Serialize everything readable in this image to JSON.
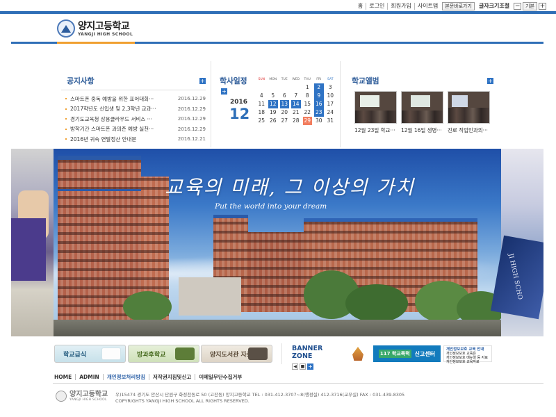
{
  "topbar": {
    "links": [
      "홈",
      "로그인",
      "회원가입",
      "사이트맵"
    ],
    "main_site": "본문바로가기",
    "font_size_label": "글자크기조절",
    "minus": "−",
    "default": "기본",
    "plus": "+"
  },
  "header": {
    "logo_kr": "양지고등학교",
    "logo_en": "YANGJI HIGH SCHOOL"
  },
  "notice": {
    "title": "공지사항",
    "more": "+",
    "items": [
      {
        "title": "스마트폰 중독 예방을 위한 표어대회···",
        "date": "2016.12.29"
      },
      {
        "title": "2017학년도 신입생 및 2,3학년 교과···",
        "date": "2016.12.29"
      },
      {
        "title": "경기도교육청 상용클라우드 서비스 ···",
        "date": "2016.12.29"
      },
      {
        "title": "방학기간 스마트폰 과의존 예방 실천···",
        "date": "2016.12.29"
      },
      {
        "title": "2016년 귀속 연말정산 안내문",
        "date": "2016.12.21"
      }
    ]
  },
  "calendar": {
    "title": "학사일정",
    "more": "+",
    "year": "2016",
    "month": "12",
    "weekdays": [
      "SUN",
      "MON",
      "TUE",
      "WED",
      "THU",
      "FRI",
      "SAT"
    ],
    "weeks": [
      [
        "",
        "",
        "",
        "",
        "1",
        "2",
        "3"
      ],
      [
        "4",
        "5",
        "6",
        "7",
        "8",
        "9",
        "10"
      ],
      [
        "11",
        "12",
        "13",
        "14",
        "15",
        "16",
        "17"
      ],
      [
        "18",
        "19",
        "20",
        "21",
        "22",
        "23",
        "24"
      ],
      [
        "25",
        "26",
        "27",
        "28",
        "29",
        "30",
        "31"
      ]
    ],
    "event_days": [
      "2",
      "9",
      "12",
      "13",
      "14",
      "16",
      "23"
    ],
    "today": "29",
    "colors": {
      "event": "#2f73c4",
      "today": "#f27d5e"
    }
  },
  "album": {
    "title": "학교앨범",
    "more": "+",
    "captions": [
      "12월 23일 학교···",
      "12월 16일 생명···",
      "진로 직업인과의···"
    ]
  },
  "hero": {
    "slogan": "교육의 미래, 그 이상의 가치",
    "subtitle": "Put the world into your dream",
    "book_text": "JI HIGH SCHO"
  },
  "quicklinks": [
    "학교급식",
    "방과후학교",
    "양지도서관 자료검색"
  ],
  "banner_zone": {
    "title": "BANNER ZONE",
    "prev": "◀",
    "stop": "■",
    "add": "+",
    "banner2": "신고센터",
    "banner2_badge": "117 학교폭력",
    "banner3_title": "개인정보보호 교육 안내",
    "banner3_lines": [
      "개인정보보호 교육은",
      "개인정보보호 매뉴얼 등 자료",
      "개인정보보호 교육자료"
    ]
  },
  "footer": {
    "nav": [
      "HOME",
      "ADMIN",
      "개인정보처리방침",
      "저작권지침및신고",
      "이메일무단수집거부"
    ],
    "logo_kr": "양지고등학교",
    "logo_en": "YANGJI HIGH SCHOOL",
    "address": "우)15474  경기도 안산시 단원구 화정천동로 50 (고잔동) 양지고등학교 TEL : 031-412-3707~8(행정실) 412-3716(교무실) FAX : 031-439-8305",
    "copyright": "COPYRIGHTS YANGJI HIGH SCHOOL ALL RIGHTS RESERVED."
  }
}
